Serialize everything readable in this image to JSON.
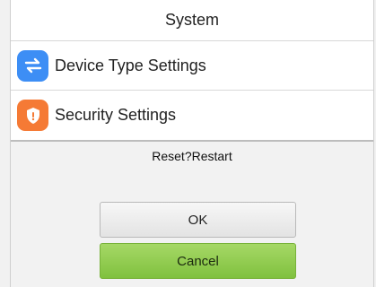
{
  "header": {
    "title": "System"
  },
  "menu": {
    "items": [
      {
        "label": "Device Type Settings",
        "icon": "swap-arrows-icon",
        "icon_color": "#3d8ef5"
      },
      {
        "label": "Security Settings",
        "icon": "shield-icon",
        "icon_color": "#f57a35"
      }
    ]
  },
  "dialog": {
    "message": "Reset?Restart",
    "ok_label": "OK",
    "cancel_label": "Cancel",
    "cancel_color": "#8cc84b"
  }
}
